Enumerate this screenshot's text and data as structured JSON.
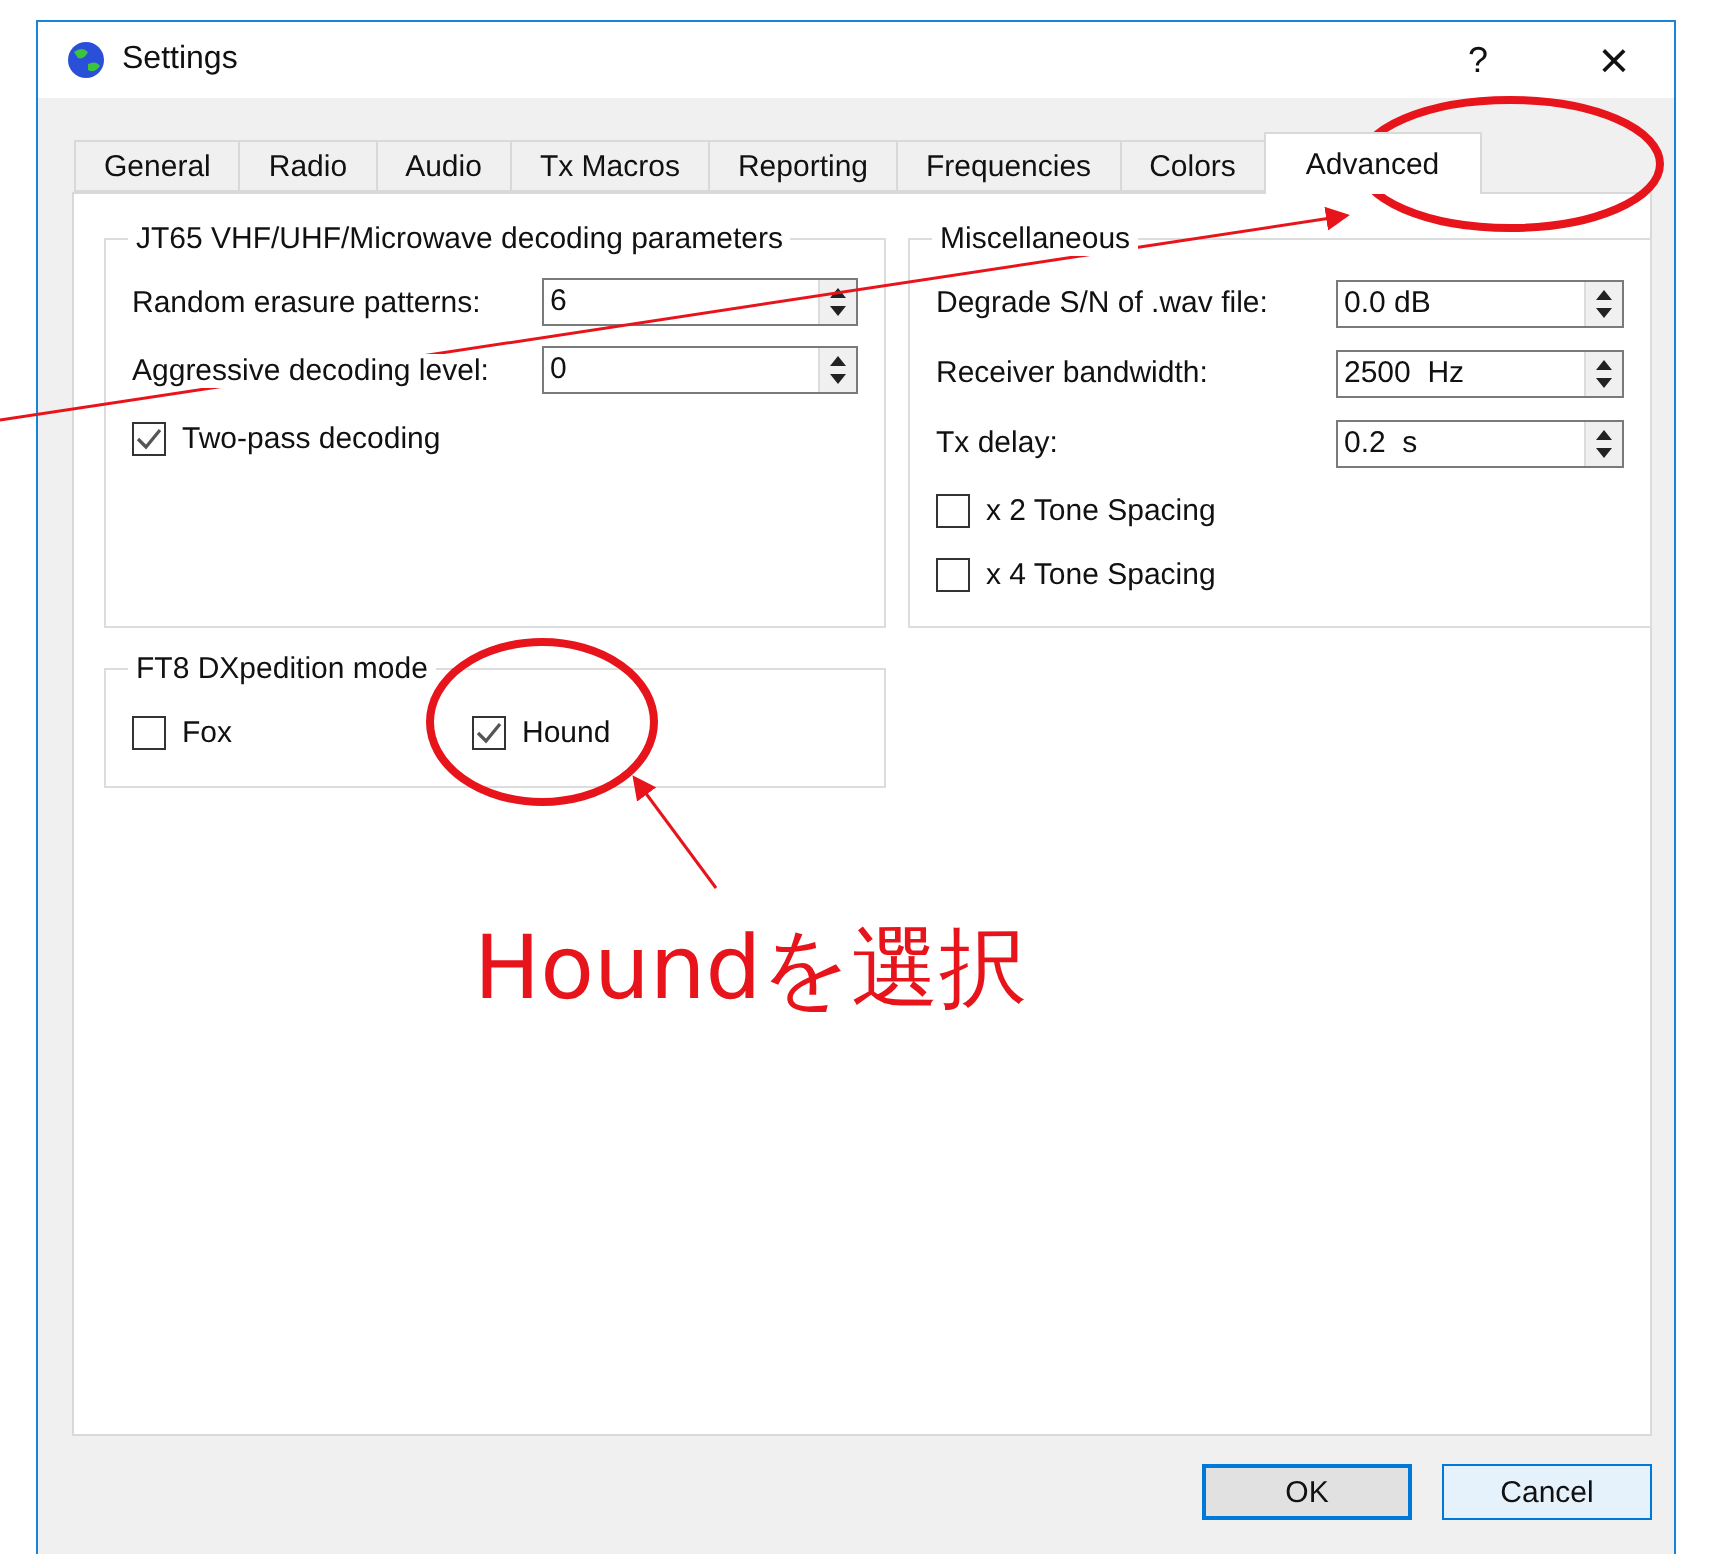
{
  "window": {
    "title": "Settings",
    "help_button": "?",
    "close_button": "×"
  },
  "tabs": [
    {
      "label": "General",
      "selected": false
    },
    {
      "label": "Radio",
      "selected": false
    },
    {
      "label": "Audio",
      "selected": false
    },
    {
      "label": "Tx Macros",
      "selected": false
    },
    {
      "label": "Reporting",
      "selected": false
    },
    {
      "label": "Frequencies",
      "selected": false
    },
    {
      "label": "Colors",
      "selected": false
    },
    {
      "label": "Advanced",
      "selected": true
    }
  ],
  "jt65_panel": {
    "title": "JT65 VHF/UHF/Microwave decoding parameters",
    "rows": [
      {
        "kind": "spin",
        "label": "Random erasure patterns:",
        "value": "6"
      },
      {
        "kind": "spin",
        "label": "Aggressive decoding level:",
        "value": "0"
      },
      {
        "kind": "check",
        "label": "Two-pass decoding",
        "checked": true
      }
    ]
  },
  "misc_panel": {
    "title": "Miscellaneous",
    "rows": [
      {
        "kind": "spin",
        "label": "Degrade S/N of .wav file:",
        "value": "0.0 dB"
      },
      {
        "kind": "spin",
        "label": "Receiver bandwidth:",
        "value": "2500  Hz"
      },
      {
        "kind": "spin",
        "label": "Tx delay:",
        "value": "0.2  s"
      },
      {
        "kind": "check",
        "label": "x 2 Tone Spacing",
        "checked": false
      },
      {
        "kind": "check",
        "label": "x 4 Tone Spacing",
        "checked": false
      }
    ]
  },
  "ft8_panel": {
    "title": "FT8 DXpedition mode",
    "options": [
      {
        "label": "Fox",
        "checked": false
      },
      {
        "label": "Hound",
        "checked": true
      }
    ]
  },
  "buttons": [
    {
      "label": "OK",
      "default": true
    },
    {
      "label": "Cancel",
      "default": false
    }
  ],
  "annotation": {
    "text": "Houndを選択"
  }
}
